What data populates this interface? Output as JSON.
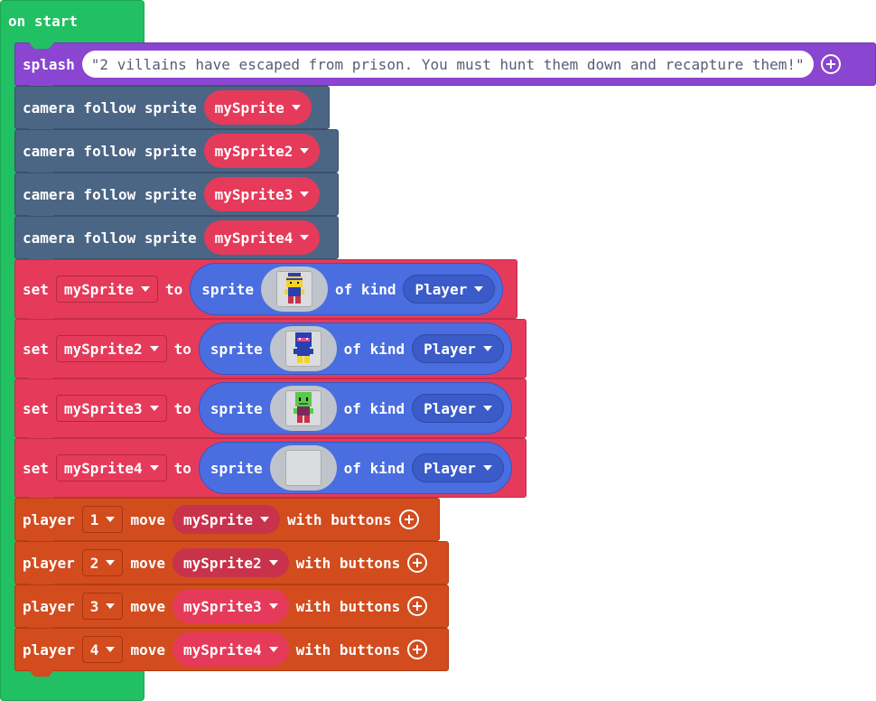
{
  "on_start": {
    "label": "on start"
  },
  "splash": {
    "keyword": "splash",
    "text": "\"2 villains have escaped from prison. You must hunt them down and recapture them!\""
  },
  "camera_blocks": [
    {
      "label": "camera follow sprite",
      "sprite": "mySprite"
    },
    {
      "label": "camera follow sprite",
      "sprite": "mySprite2"
    },
    {
      "label": "camera follow sprite",
      "sprite": "mySprite3"
    },
    {
      "label": "camera follow sprite",
      "sprite": "mySprite4"
    }
  ],
  "set_blocks": [
    {
      "set": "set",
      "var": "mySprite",
      "to": "to",
      "sprite": "sprite",
      "image": "yellow-hero-sprite-icon",
      "of_kind": "of kind",
      "kind": "Player"
    },
    {
      "set": "set",
      "var": "mySprite2",
      "to": "to",
      "sprite": "sprite",
      "image": "blue-ninja-sprite-icon",
      "of_kind": "of kind",
      "kind": "Player"
    },
    {
      "set": "set",
      "var": "mySprite3",
      "to": "to",
      "sprite": "sprite",
      "image": "green-alien-sprite-icon",
      "of_kind": "of kind",
      "kind": "Player"
    },
    {
      "set": "set",
      "var": "mySprite4",
      "to": "to",
      "sprite": "sprite",
      "image": "empty-sprite-icon",
      "of_kind": "of kind",
      "kind": "Player"
    }
  ],
  "player_blocks": [
    {
      "player": "player",
      "num": "1",
      "move": "move",
      "sprite": "mySprite",
      "with": "with buttons"
    },
    {
      "player": "player",
      "num": "2",
      "move": "move",
      "sprite": "mySprite2",
      "with": "with buttons"
    },
    {
      "player": "player",
      "num": "3",
      "move": "move",
      "sprite": "mySprite3",
      "with": "with buttons"
    },
    {
      "player": "player",
      "num": "4",
      "move": "move",
      "sprite": "mySprite4",
      "with": "with buttons"
    }
  ],
  "colors": {
    "loops_green": "#21c063",
    "splash_purple": "#8a46d0",
    "camera_slate": "#4b6584",
    "sprites_red": "#e63a5a",
    "sprite_blue": "#4a6de0",
    "controller_orange": "#d24c1e"
  }
}
